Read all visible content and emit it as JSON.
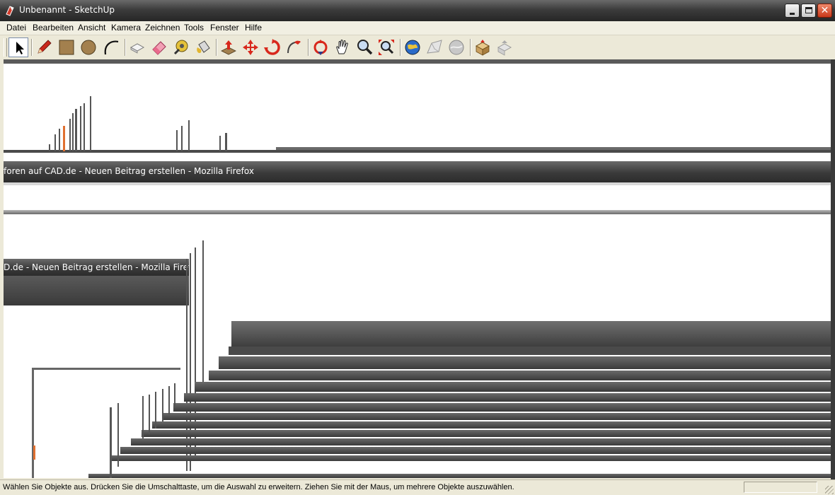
{
  "window": {
    "title": "Unbenannt - SketchUp"
  },
  "menu": [
    "Datei",
    "Bearbeiten",
    "Ansicht",
    "Kamera",
    "Zeichnen",
    "Tools",
    "Fenster",
    "Hilfe"
  ],
  "toolbar": {
    "tools": [
      {
        "name": "select-tool-button",
        "icon": "arrow-cursor-icon",
        "pressed": true
      },
      {
        "name": "line-tool-button",
        "icon": "pencil-icon"
      },
      {
        "name": "rectangle-tool-button",
        "icon": "rectangle-icon"
      },
      {
        "name": "circle-tool-button",
        "icon": "circle-icon"
      },
      {
        "name": "arc-tool-button",
        "icon": "arc-icon"
      },
      {
        "name": "make-component-button",
        "icon": "component-icon"
      },
      {
        "name": "eraser-tool-button",
        "icon": "eraser-icon"
      },
      {
        "name": "tape-measure-tool-button",
        "icon": "tape-measure-icon"
      },
      {
        "name": "paint-bucket-tool-button",
        "icon": "paint-bucket-icon"
      },
      {
        "name": "push-pull-tool-button",
        "icon": "push-pull-icon"
      },
      {
        "name": "move-tool-button",
        "icon": "move-icon"
      },
      {
        "name": "rotate-tool-button",
        "icon": "rotate-icon"
      },
      {
        "name": "follow-me-tool-button",
        "icon": "follow-me-icon"
      },
      {
        "name": "orbit-tool-button",
        "icon": "orbit-icon"
      },
      {
        "name": "pan-tool-button",
        "icon": "hand-icon"
      },
      {
        "name": "zoom-tool-button",
        "icon": "zoom-icon"
      },
      {
        "name": "zoom-extents-button",
        "icon": "zoom-extents-icon"
      },
      {
        "name": "google-earth-button",
        "icon": "globe-icon"
      },
      {
        "name": "toggle-terrain-button",
        "icon": "terrain-icon"
      },
      {
        "name": "place-model-button",
        "icon": "place-model-icon"
      },
      {
        "name": "get-models-button",
        "icon": "get-models-icon"
      },
      {
        "name": "share-model-button",
        "icon": "share-model-icon"
      }
    ]
  },
  "viewport": {
    "ghost_titles": [
      "foren auf CAD.de - Neuen Beitrag erstellen - Mozilla Firefox",
      "D.de - Neuen Beitrag erstellen - Mozilla Firefox"
    ]
  },
  "status": {
    "text": "Wählen Sie Objekte aus. Drücken Sie die Umschalttaste, um die Auswahl zu erweitern. Ziehen Sie mit der Maus, um mehrere Objekte auszuwählen."
  }
}
